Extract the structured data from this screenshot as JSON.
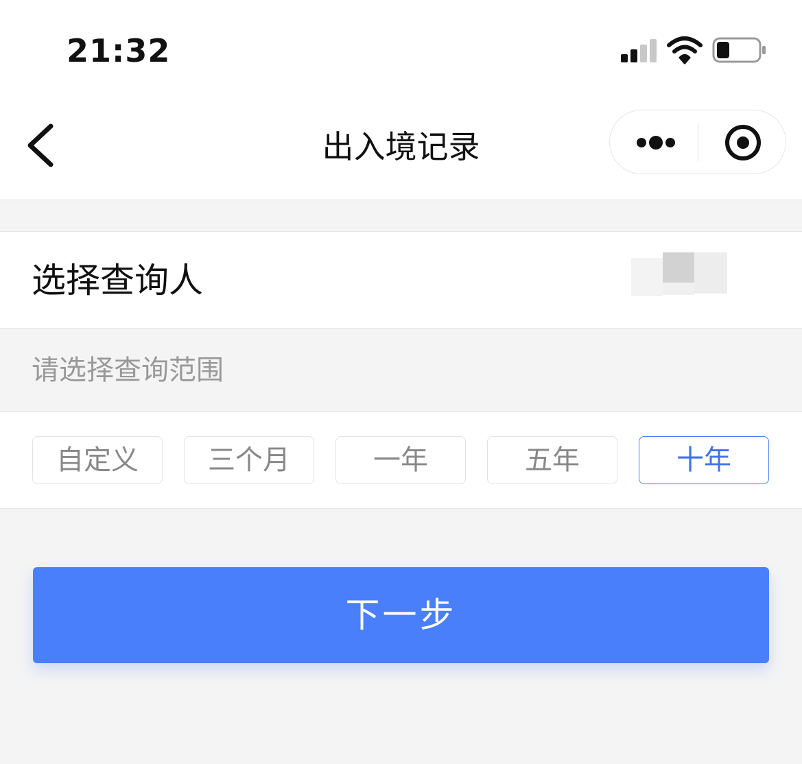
{
  "status_bar": {
    "time": "21:32",
    "signal_icon": "cellular-signal-icon",
    "wifi_icon": "wifi-icon",
    "battery_icon": "battery-icon",
    "battery_level": 0.25
  },
  "nav": {
    "back_icon": "chevron-left-icon",
    "title": "出入境记录",
    "more_icon": "more-dots-icon",
    "close_icon": "target-circle-icon"
  },
  "person": {
    "label": "选择查询人"
  },
  "range": {
    "hint": "请选择查询范围",
    "options": [
      {
        "label": "自定义",
        "selected": false
      },
      {
        "label": "三个月",
        "selected": false
      },
      {
        "label": "一年",
        "selected": false
      },
      {
        "label": "五年",
        "selected": false
      },
      {
        "label": "十年",
        "selected": true
      }
    ]
  },
  "actions": {
    "next_label": "下一步"
  },
  "colors": {
    "accent": "#4a7ffc",
    "selected_text": "#3d73f0",
    "background": "#f4f4f4"
  }
}
